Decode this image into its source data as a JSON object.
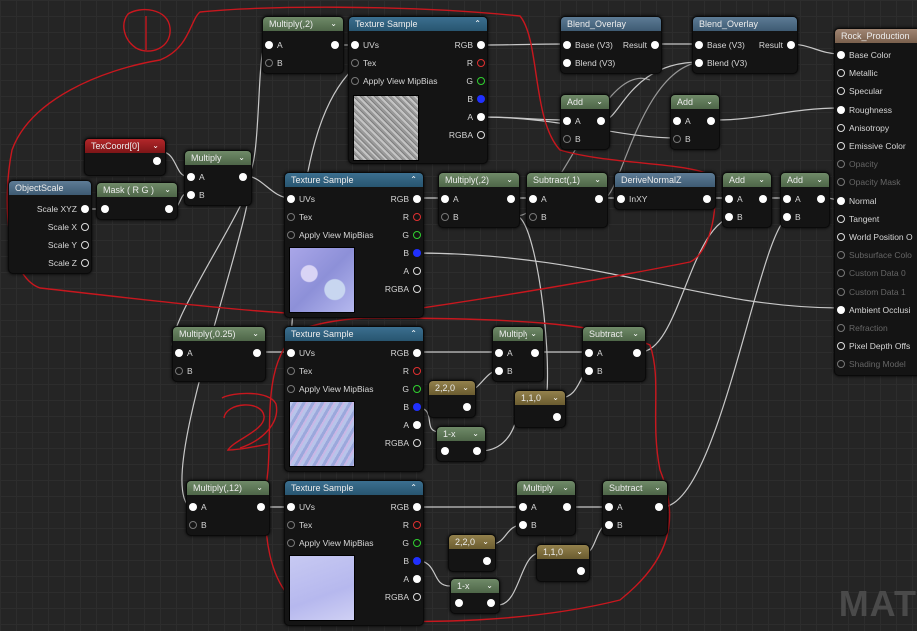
{
  "colors": {
    "wire": "#c8c8c8",
    "annotation": "#c8171e"
  },
  "annotations": {
    "one": "1",
    "two": "2"
  },
  "nodes": {
    "multiply2_top": {
      "title": "Multiply(,2)",
      "pins_in": [
        "A",
        "B"
      ]
    },
    "tex_top": {
      "title": "Texture Sample",
      "pins_in": [
        "UVs",
        "Tex",
        "Apply View MipBias"
      ],
      "pins_out": [
        "RGB",
        "R",
        "G",
        "B",
        "A",
        "RGBA"
      ]
    },
    "blend1": {
      "title": "Blend_Overlay",
      "pins_in": [
        "Base (V3)",
        "Blend (V3)"
      ],
      "pins_out": [
        "Result"
      ]
    },
    "blend2": {
      "title": "Blend_Overlay",
      "pins_in": [
        "Base (V3)",
        "Blend (V3)"
      ],
      "pins_out": [
        "Result"
      ]
    },
    "add_a": {
      "title": "Add",
      "pins_in": [
        "A",
        "B"
      ]
    },
    "add_b": {
      "title": "Add",
      "pins_in": [
        "A",
        "B"
      ]
    },
    "texcoord": {
      "title": "TexCoord[0]"
    },
    "multiply_mid": {
      "title": "Multiply",
      "pins_in": [
        "A",
        "B"
      ]
    },
    "objectscale": {
      "title": "ObjectScale",
      "pins_out": [
        "Scale XYZ",
        "Scale X",
        "Scale Y",
        "Scale Z"
      ]
    },
    "mask": {
      "title": "Mask ( R G )"
    },
    "tex_mid": {
      "title": "Texture Sample",
      "pins_in": [
        "UVs",
        "Tex",
        "Apply View MipBias"
      ],
      "pins_out": [
        "RGB",
        "R",
        "G",
        "B",
        "A",
        "RGBA"
      ]
    },
    "multiply2_mid": {
      "title": "Multiply(,2)",
      "pins_in": [
        "A",
        "B"
      ]
    },
    "subtract1": {
      "title": "Subtract(,1)",
      "pins_in": [
        "A",
        "B"
      ]
    },
    "derive": {
      "title": "DeriveNormalZ",
      "pins_in": [
        "InXY"
      ]
    },
    "add_c": {
      "title": "Add",
      "pins_in": [
        "A",
        "B"
      ]
    },
    "add_d": {
      "title": "Add",
      "pins_in": [
        "A",
        "B"
      ]
    },
    "material": {
      "title": "Rock_Production",
      "pins": [
        {
          "label": "Base Color",
          "active": true
        },
        {
          "label": "Metallic",
          "active": true
        },
        {
          "label": "Specular",
          "active": true
        },
        {
          "label": "Roughness",
          "active": true
        },
        {
          "label": "Anisotropy",
          "active": true
        },
        {
          "label": "Emissive Color",
          "active": true
        },
        {
          "label": "Opacity",
          "active": false
        },
        {
          "label": "Opacity Mask",
          "active": false
        },
        {
          "label": "Normal",
          "active": true
        },
        {
          "label": "Tangent",
          "active": true
        },
        {
          "label": "World Position O",
          "active": true
        },
        {
          "label": "Subsurface Colo",
          "active": false
        },
        {
          "label": "Custom Data 0",
          "active": false
        },
        {
          "label": "Custom Data 1",
          "active": false
        },
        {
          "label": "Ambient Occlusi",
          "active": true
        },
        {
          "label": "Refraction",
          "active": false
        },
        {
          "label": "Pixel Depth Offs",
          "active": true
        },
        {
          "label": "Shading Model",
          "active": false
        }
      ]
    },
    "multiply025": {
      "title": "Multiply(,0.25)",
      "pins_in": [
        "A",
        "B"
      ]
    },
    "tex_low1": {
      "title": "Texture Sample",
      "pins_in": [
        "UVs",
        "Tex",
        "Apply View MipBias"
      ],
      "pins_out": [
        "RGB",
        "R",
        "G",
        "B",
        "A",
        "RGBA"
      ]
    },
    "multiply_low1": {
      "title": "Multiply",
      "pins_in": [
        "A",
        "B"
      ]
    },
    "subtract_low1": {
      "title": "Subtract",
      "pins_in": [
        "A",
        "B"
      ]
    },
    "const220_1": {
      "title": "2,2,0"
    },
    "const110_1": {
      "title": "1,1,0"
    },
    "oneminus_1": {
      "title": "1-x"
    },
    "multiply12": {
      "title": "Multiply(,12)",
      "pins_in": [
        "A",
        "B"
      ]
    },
    "tex_low2": {
      "title": "Texture Sample",
      "pins_in": [
        "UVs",
        "Tex",
        "Apply View MipBias"
      ],
      "pins_out": [
        "RGB",
        "R",
        "G",
        "B",
        "A",
        "RGBA"
      ]
    },
    "multiply_low2": {
      "title": "Multiply",
      "pins_in": [
        "A",
        "B"
      ]
    },
    "subtract_low2": {
      "title": "Subtract",
      "pins_in": [
        "A",
        "B"
      ]
    },
    "const220_2": {
      "title": "2,2,0"
    },
    "const110_2": {
      "title": "1,1,0"
    },
    "oneminus_2": {
      "title": "1-x"
    }
  },
  "watermark": "MAT"
}
